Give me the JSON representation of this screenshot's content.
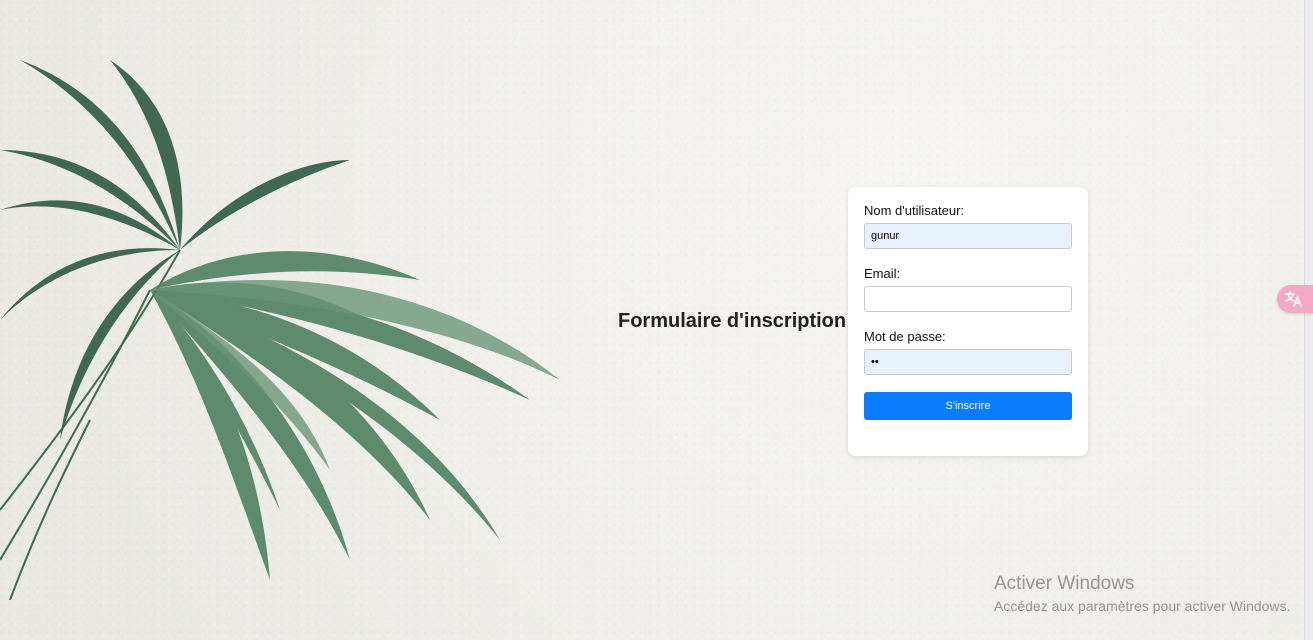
{
  "form": {
    "heading": "Formulaire d'inscription :",
    "username": {
      "label": "Nom d'utilisateur:",
      "value": "gunur"
    },
    "email": {
      "label": "Email:",
      "value": ""
    },
    "password": {
      "label": "Mot de passe:",
      "value": "••"
    },
    "submit_label": "S'inscrire"
  },
  "watermark": {
    "title": "Activer Windows",
    "subtitle": "Accédez aux paramètres pour activer Windows."
  },
  "icons": {
    "translate": "translate-icon",
    "background": "palm-plant-illustration"
  },
  "colors": {
    "button": "#0a7cff",
    "autofill": "#e8f0fe",
    "translate_tab": "#f3a9c3"
  }
}
